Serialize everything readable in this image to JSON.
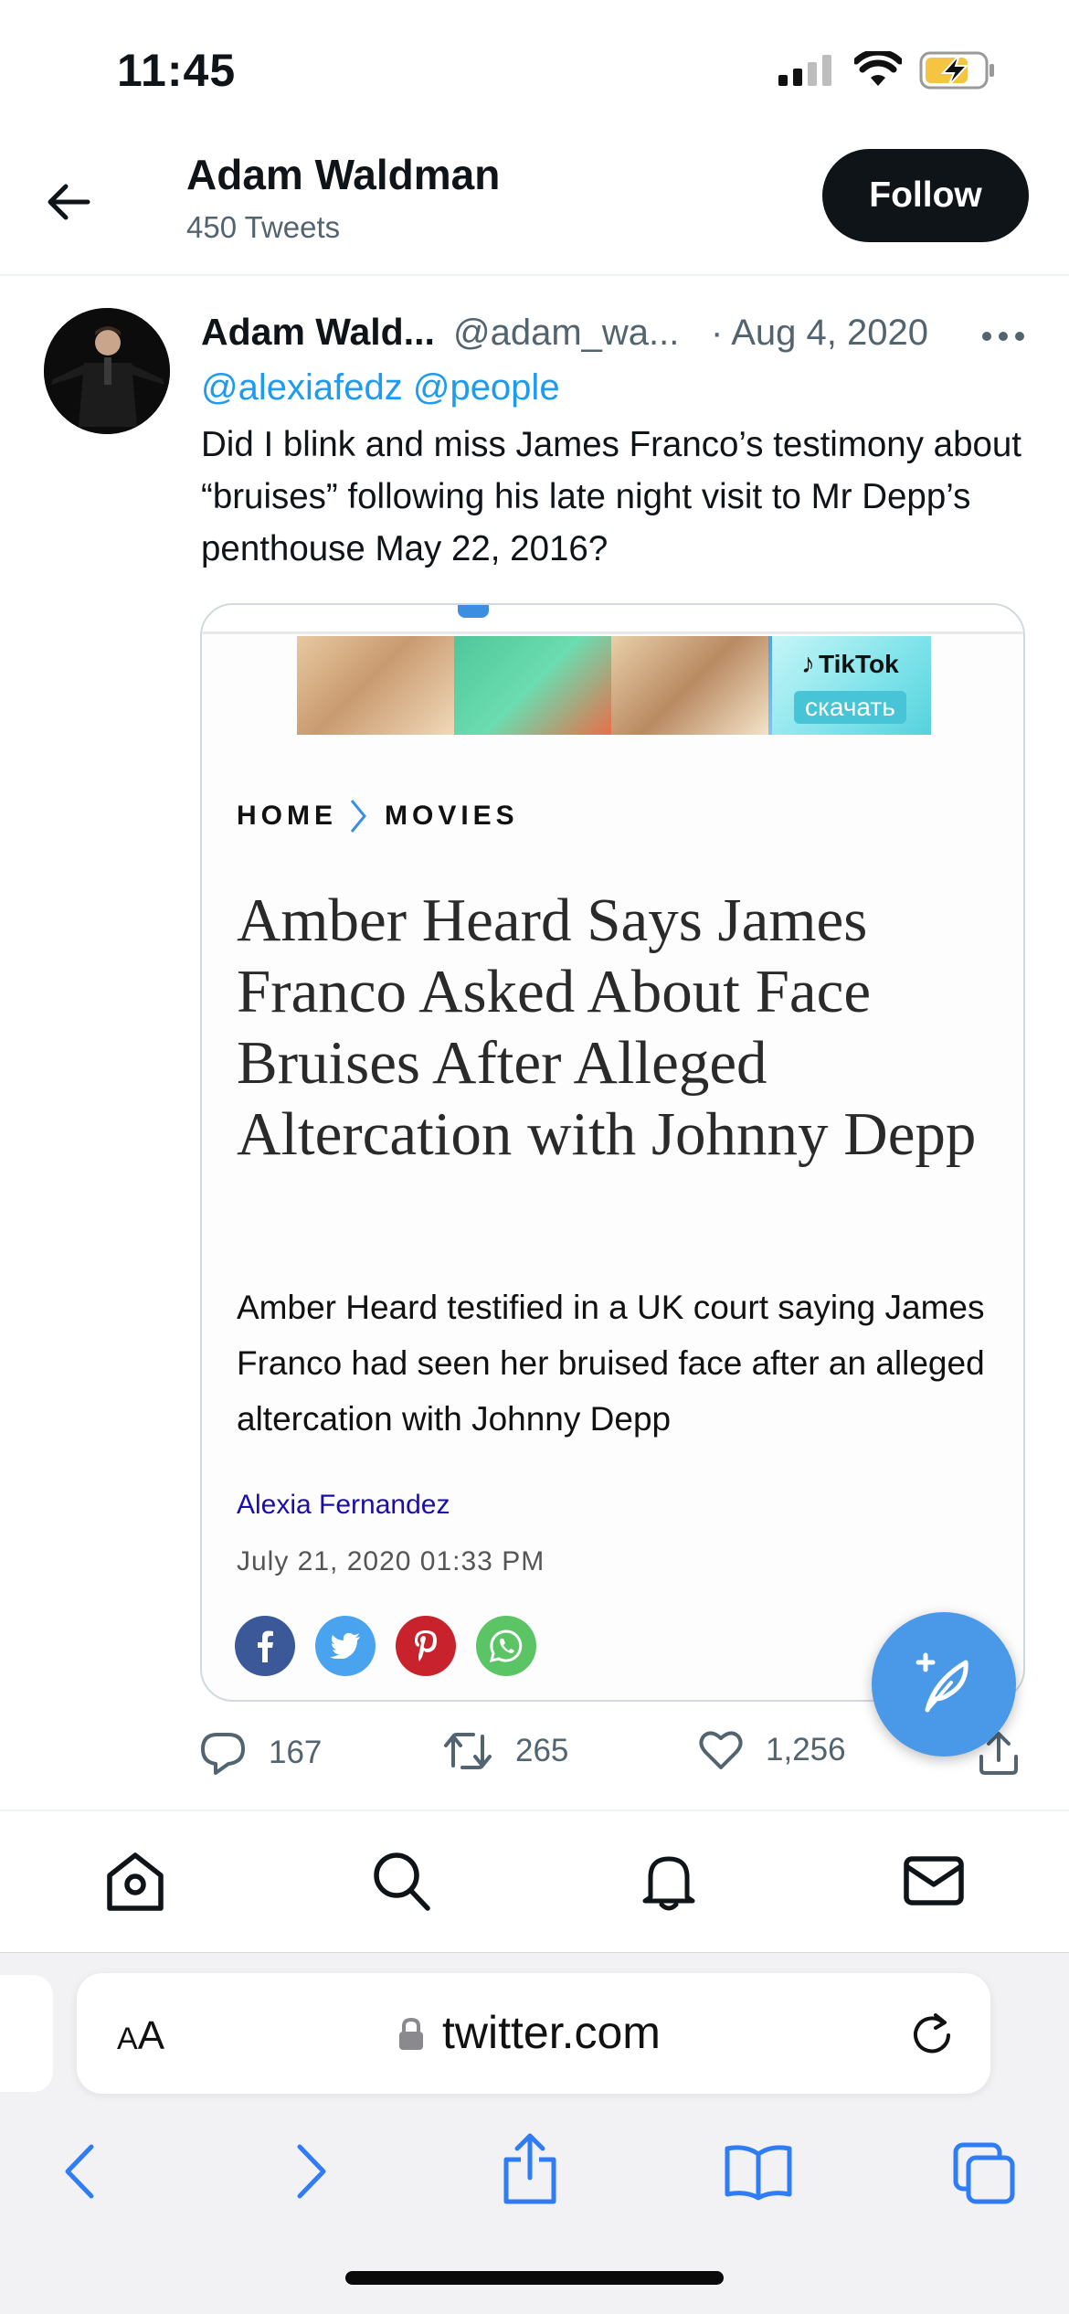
{
  "status_bar": {
    "time": "11:45",
    "icons": [
      "signal-icon",
      "wifi-icon",
      "battery-charging-icon"
    ],
    "battery_color": "#f5c542"
  },
  "header": {
    "name": "Adam Waldman",
    "tweet_count": "450 Tweets",
    "follow_label": "Follow"
  },
  "tweet": {
    "author_name": "Adam Wald...",
    "handle": "@adam_wa...",
    "date": "· Aug 4, 2020",
    "mentions": "@alexiafedz @people",
    "text": "Did I blink and miss James Franco’s testimony about “bruises” following his late night visit to Mr Depp’s penthouse May 22, 2016?",
    "card": {
      "ad": {
        "brand": "TikTok",
        "cta": "скачать"
      },
      "breadcrumb": [
        "HOME",
        "MOVIES"
      ],
      "headline": "Amber Heard Says James Franco Asked About Face Bruises After Alleged Altercation with Johnny Depp",
      "summary": "Amber Heard testified in a UK court saying James Franco had seen her bruised face after an alleged altercation with Johnny Depp",
      "author": "Alexia Fernandez",
      "date": "July 21, 2020 01:33 PM",
      "share_icons": [
        "facebook-icon",
        "twitter-icon",
        "pinterest-icon",
        "whatsapp-icon"
      ]
    },
    "actions": {
      "replies": "167",
      "retweets": "265",
      "likes": "1,256"
    }
  },
  "tab_bar": [
    "home-icon",
    "search-icon",
    "bell-icon",
    "mail-icon"
  ],
  "safari": {
    "text_size_label_small": "A",
    "text_size_label_large": "A",
    "url": "twitter.com"
  },
  "colors": {
    "accent": "#1d9bf0",
    "text": "#0f1419",
    "secondary_text": "#536471",
    "compose_button": "#4a99e9"
  }
}
